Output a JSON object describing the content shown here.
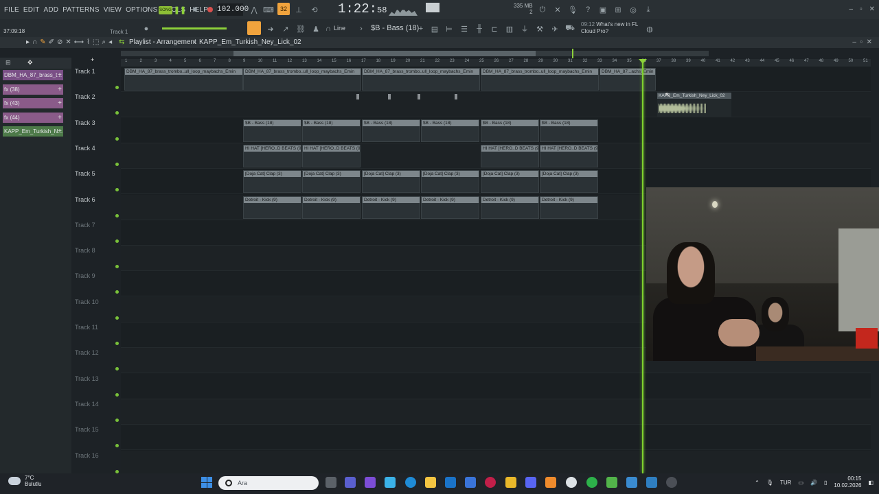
{
  "menu": [
    "FILE",
    "EDIT",
    "ADD",
    "PATTERNS",
    "VIEW",
    "OPTIONS",
    "TOOLS",
    "HELP"
  ],
  "transport": {
    "song_label": "SONG",
    "tempo": "102.000",
    "time_main": "1:22",
    "time_sub": "58",
    "pattern_num": "32",
    "memory": "335 MB",
    "memory_sub": "2"
  },
  "toolbar2": {
    "clock": "37:09:18",
    "track_hint": "Track 1",
    "snap": "Line",
    "channel": "$B - Bass (18)",
    "news_time": "09:12",
    "news_text1": "What's new in FL",
    "news_text2": "Cloud Pro?"
  },
  "playlist": {
    "title": "Playlist - Arrangement",
    "separator": "›",
    "subtitle": "KAPP_Em_Turkish_Ney_Lick_02"
  },
  "picker": [
    {
      "label": "DBM_HA_87_brass_t...",
      "color": "#7a4f86"
    },
    {
      "label": "fx (38)",
      "color": "#8a5b89"
    },
    {
      "label": "fx (43)",
      "color": "#8a5b89"
    },
    {
      "label": "fx (44)",
      "color": "#8a5b89"
    },
    {
      "label": "KAPP_Em_Turkish_N...",
      "color": "#4d7a49"
    }
  ],
  "tracks": [
    "Track 1",
    "Track 2",
    "Track 3",
    "Track 4",
    "Track 5",
    "Track 6",
    "Track 7",
    "Track 8",
    "Track 9",
    "Track 10",
    "Track 11",
    "Track 12",
    "Track 13",
    "Track 14",
    "Track 15",
    "Track 16"
  ],
  "ruler": [
    "1",
    "2",
    "3",
    "4",
    "5",
    "6",
    "7",
    "8",
    "9",
    "10",
    "11",
    "12",
    "13",
    "14",
    "15",
    "16",
    "17",
    "18",
    "19",
    "20",
    "21",
    "22",
    "23",
    "24",
    "25",
    "26",
    "27",
    "28",
    "29",
    "30",
    "31",
    "32",
    "33",
    "34",
    "35",
    "36",
    "37",
    "38",
    "39",
    "40",
    "41",
    "42",
    "43",
    "44",
    "45",
    "46",
    "47",
    "48",
    "49",
    "50",
    "51"
  ],
  "clips": {
    "brass": "DBM_HA_87_brass_trombo..ull_loop_maybachs_Emin",
    "brass_last": "DBM_HA_87...achs_Emin",
    "db": "-10.4dB",
    "bass": "$B - Bass (18)",
    "hihat": "HI HAT [HERO..D BEATS (9)",
    "clap": "[Doja Cat] Clap (3)",
    "kick": "Detroit - Kick (9)",
    "ney": "KAPP_Em_Turkish_Ney_Lick_02"
  },
  "taskbar": {
    "temp": "7°C",
    "weather": "Bulutlu",
    "search_placeholder": "Ara",
    "lang": "TUR",
    "time": "00:15",
    "date": "10.02.2026"
  }
}
